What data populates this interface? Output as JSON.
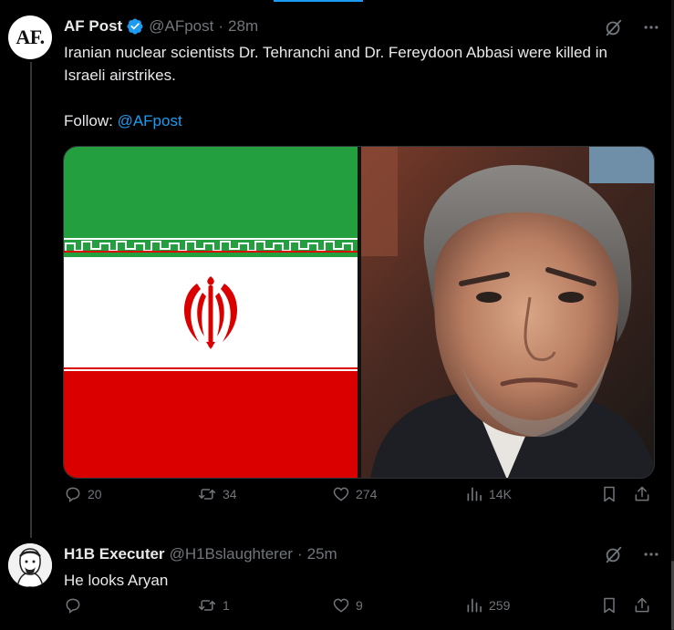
{
  "tweet": {
    "author_name": "AF Post",
    "handle": "@AFpost",
    "separator": "·",
    "time": "28m",
    "avatar_text": "AF.",
    "text": "Iranian nuclear scientists Dr. Tehranchi and Dr. Fereydoon Abbasi were killed in Israeli airstrikes.",
    "follow_prefix": "Follow: ",
    "follow_link": "@AFpost",
    "stats": {
      "replies": "20",
      "reposts": "34",
      "likes": "274",
      "views": "14K"
    }
  },
  "reply": {
    "author_name": "H1B Executer",
    "handle": "@H1Bslaughterer",
    "separator": "·",
    "time": "25m",
    "text": "He looks Aryan",
    "stats": {
      "replies": "",
      "reposts": "1",
      "likes": "9",
      "views": "259"
    }
  },
  "colors": {
    "background": "#000000",
    "text": "#e7e9ea",
    "muted": "#71767b",
    "accent": "#1d9bf0",
    "flag_green": "#239f40",
    "flag_red": "#da0000"
  },
  "icons": [
    "verified-badge-icon",
    "grok-icon",
    "more-icon",
    "reply-icon",
    "repost-icon",
    "like-icon",
    "views-icon",
    "bookmark-icon",
    "share-icon"
  ]
}
